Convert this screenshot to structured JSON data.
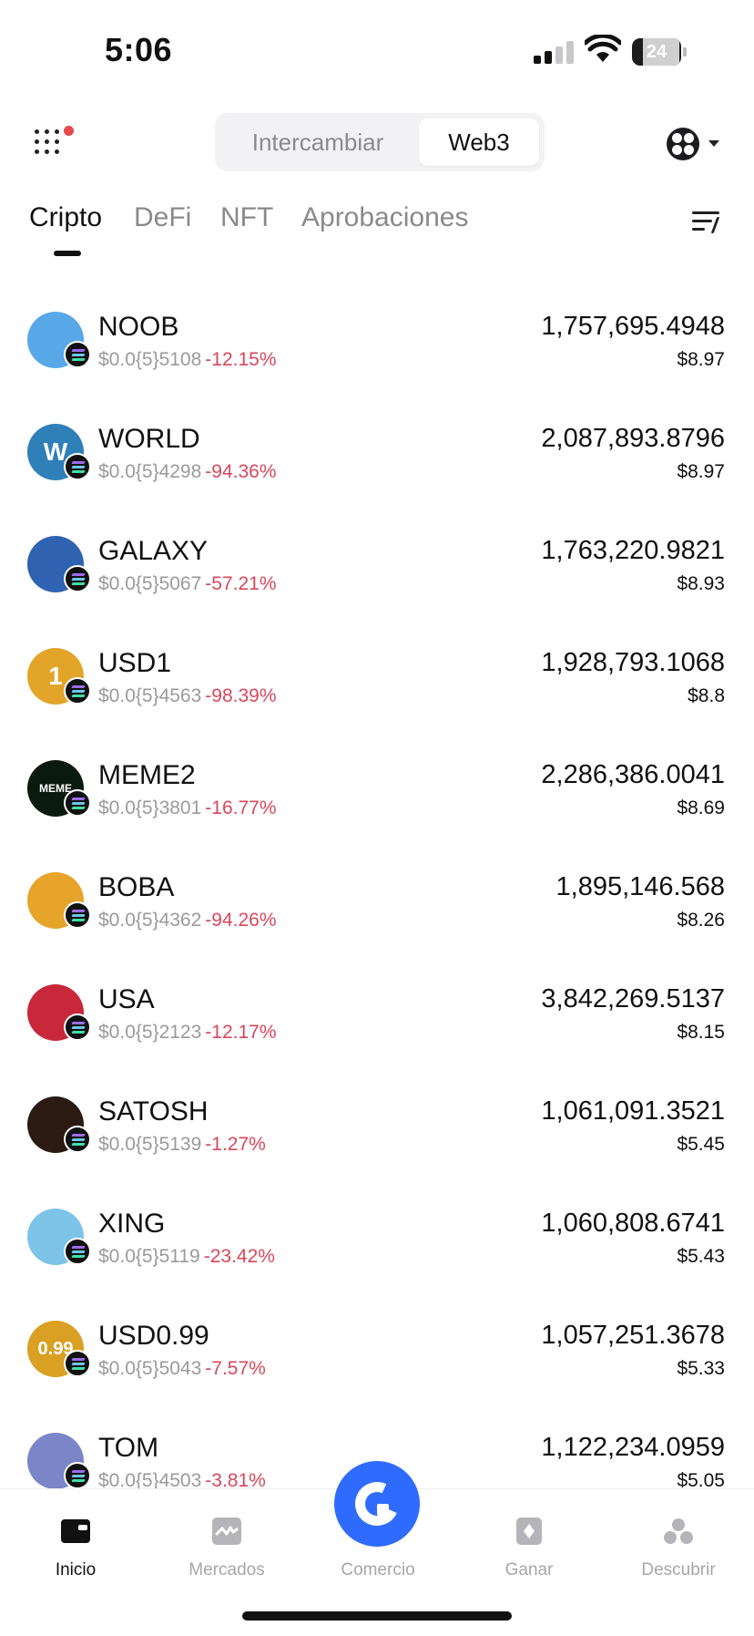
{
  "status_bar": {
    "time": "5:06",
    "battery": "24",
    "battery_level": 0.24
  },
  "header": {
    "segments": [
      "Intercambiar",
      "Web3"
    ],
    "active_segment": "Web3"
  },
  "tabs": [
    {
      "label": "Cripto",
      "active": true
    },
    {
      "label": "DeFi",
      "active": false
    },
    {
      "label": "NFT",
      "active": false
    },
    {
      "label": "Aprobaciones",
      "active": false
    }
  ],
  "tokens": [
    {
      "symbol": "NOOB",
      "price": "$0.0{5}5108",
      "change": "-12.15%",
      "balance": "1,757,695.4948",
      "value": "$8.97",
      "logo_color": "#58a8e8"
    },
    {
      "symbol": "WORLD",
      "price": "$0.0{5}4298",
      "change": "-94.36%",
      "balance": "2,087,893.8796",
      "value": "$8.97",
      "logo_color": "#2f7fb8"
    },
    {
      "symbol": "GALAXY",
      "price": "$0.0{5}5067",
      "change": "-57.21%",
      "balance": "1,763,220.9821",
      "value": "$8.93",
      "logo_color": "#2f62b0"
    },
    {
      "symbol": "USD1",
      "price": "$0.0{5}4563",
      "change": "-98.39%",
      "balance": "1,928,793.1068",
      "value": "$8.8",
      "logo_color": "#e2a52a"
    },
    {
      "symbol": "MEME2",
      "price": "$0.0{5}3801",
      "change": "-16.77%",
      "balance": "2,286,386.0041",
      "value": "$8.69",
      "logo_color": "#0b1a0f"
    },
    {
      "symbol": "BOBA",
      "price": "$0.0{5}4362",
      "change": "-94.26%",
      "balance": "1,895,146.568",
      "value": "$8.26",
      "logo_color": "#e7a42a"
    },
    {
      "symbol": "USA",
      "price": "$0.0{5}2123",
      "change": "-12.17%",
      "balance": "3,842,269.5137",
      "value": "$8.15",
      "logo_color": "#c8283a"
    },
    {
      "symbol": "SATOSH",
      "price": "$0.0{5}5139",
      "change": "-1.27%",
      "balance": "1,061,091.3521",
      "value": "$5.45",
      "logo_color": "#2a1a12"
    },
    {
      "symbol": "XING",
      "price": "$0.0{5}5119",
      "change": "-23.42%",
      "balance": "1,060,808.6741",
      "value": "$5.43",
      "logo_color": "#7cc4e8"
    },
    {
      "symbol": "USD0.99",
      "price": "$0.0{5}5043",
      "change": "-7.57%",
      "balance": "1,057,251.3678",
      "value": "$5.33",
      "logo_color": "#d9a024"
    },
    {
      "symbol": "TOM",
      "price": "$0.0{5}4503",
      "change": "-3.81%",
      "balance": "1,122,234.0959",
      "value": "$5.05",
      "logo_color": "#7a86c8"
    }
  ],
  "token_logo_text": [
    "",
    "W",
    "",
    "1",
    "MEME",
    "",
    "",
    "",
    "",
    "0.99",
    ""
  ],
  "bottom_nav": [
    {
      "label": "Inicio",
      "active": true,
      "icon": "wallet-icon"
    },
    {
      "label": "Mercados",
      "active": false,
      "icon": "chart-icon"
    },
    {
      "label": "Comercio",
      "active": false,
      "icon": "trade-icon"
    },
    {
      "label": "Ganar",
      "active": false,
      "icon": "earn-icon"
    },
    {
      "label": "Descubrir",
      "active": false,
      "icon": "discover-icon"
    }
  ],
  "colors": {
    "accent": "#2f6bff",
    "negative": "#d9475b",
    "muted": "#9a9a9e"
  }
}
